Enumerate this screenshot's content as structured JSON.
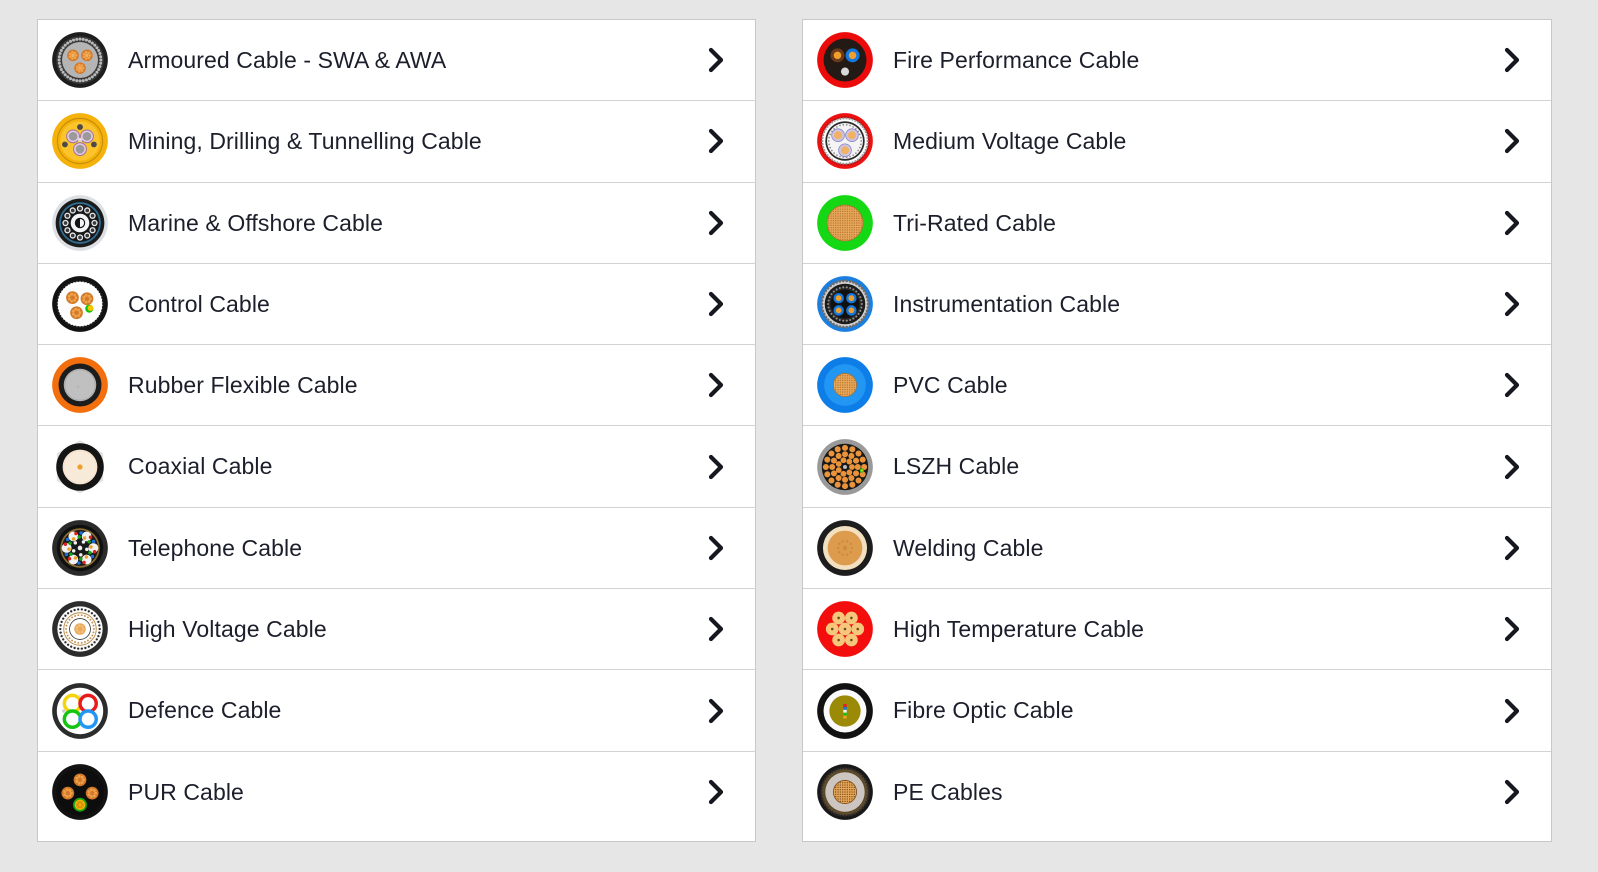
{
  "page": {
    "background_color": "#e6e6e6",
    "card_background_color": "#ffffff",
    "card_border_color": "#c8c8c8",
    "row_divider_color": "#d2d2d2",
    "label_color": "#1c1f2b",
    "chevron_color": "#16181f",
    "chevron_icon": "chevron-right-icon"
  },
  "columns": [
    {
      "name": "left-column",
      "rows": [
        {
          "label": "Armoured Cable - SWA & AWA",
          "icon": "armoured-cable-icon"
        },
        {
          "label": "Mining, Drilling & Tunnelling Cable",
          "icon": "mining-drilling-tunnelling-cable-icon"
        },
        {
          "label": "Marine & Offshore Cable",
          "icon": "marine-offshore-cable-icon"
        },
        {
          "label": "Control Cable",
          "icon": "control-cable-icon"
        },
        {
          "label": "Rubber Flexible Cable",
          "icon": "rubber-flexible-cable-icon"
        },
        {
          "label": "Coaxial Cable",
          "icon": "coaxial-cable-icon"
        },
        {
          "label": "Telephone Cable",
          "icon": "telephone-cable-icon"
        },
        {
          "label": "High Voltage Cable",
          "icon": "high-voltage-cable-icon"
        },
        {
          "label": "Defence Cable",
          "icon": "defence-cable-icon"
        },
        {
          "label": "PUR Cable",
          "icon": "pur-cable-icon"
        }
      ]
    },
    {
      "name": "right-column",
      "rows": [
        {
          "label": "Fire Performance Cable",
          "icon": "fire-performance-cable-icon"
        },
        {
          "label": "Medium Voltage Cable",
          "icon": "medium-voltage-cable-icon"
        },
        {
          "label": "Tri-Rated Cable",
          "icon": "tri-rated-cable-icon"
        },
        {
          "label": "Instrumentation Cable",
          "icon": "instrumentation-cable-icon"
        },
        {
          "label": "PVC Cable",
          "icon": "pvc-cable-icon"
        },
        {
          "label": "LSZH Cable",
          "icon": "lszh-cable-icon"
        },
        {
          "label": "Welding Cable",
          "icon": "welding-cable-icon"
        },
        {
          "label": "High Temperature Cable",
          "icon": "high-temperature-cable-icon"
        },
        {
          "label": "Fibre Optic Cable",
          "icon": "fibre-optic-cable-icon"
        },
        {
          "label": "PE Cables",
          "icon": "pe-cables-icon"
        }
      ]
    }
  ]
}
